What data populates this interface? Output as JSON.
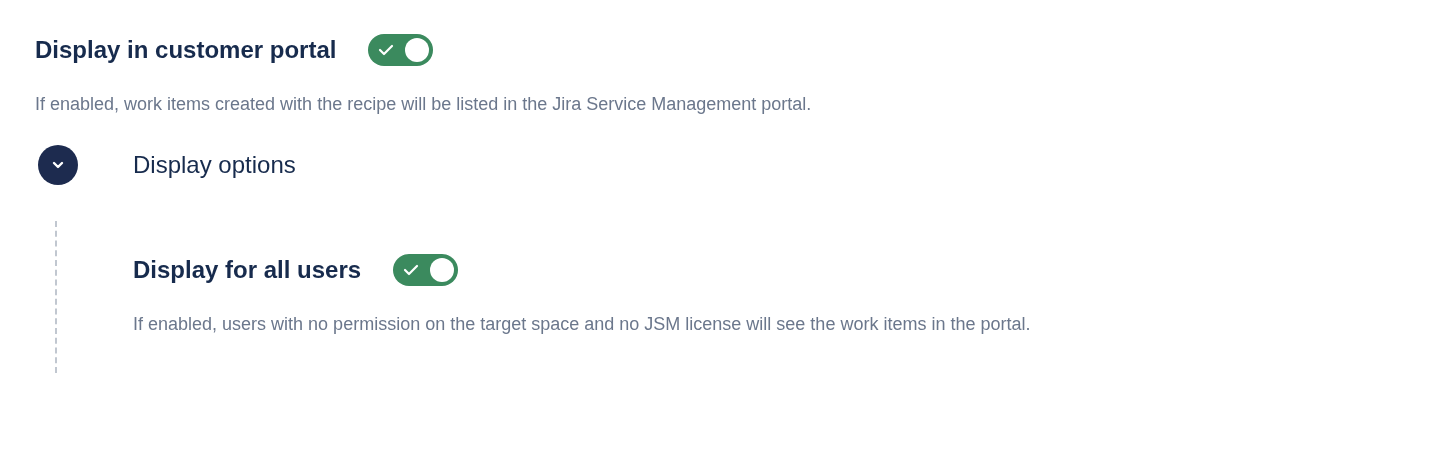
{
  "setting": {
    "title": "Display in customer portal",
    "on": true,
    "description": "If enabled, work items created with the recipe will be listed in the Jira Service Management portal."
  },
  "section": {
    "title": "Display options",
    "expanded": true,
    "settings": [
      {
        "title": "Display for all users",
        "on": true,
        "description": "If enabled, users with no permission on the target space and no JSM license will see the work items in the portal."
      }
    ]
  }
}
